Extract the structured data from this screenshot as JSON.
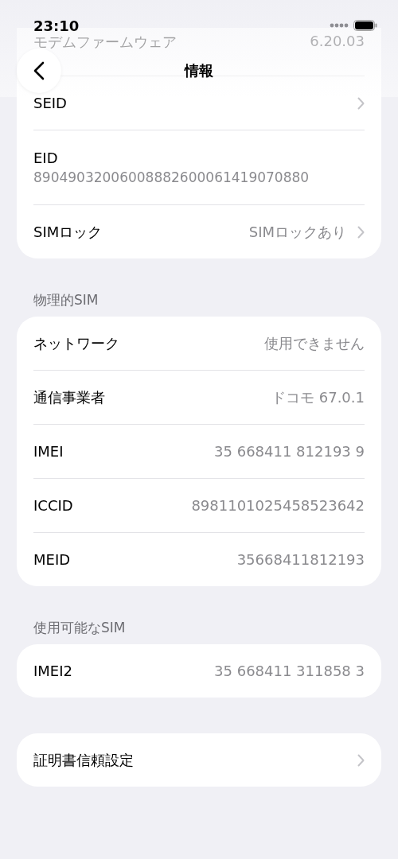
{
  "status_bar": {
    "time": "23:10"
  },
  "nav": {
    "title": "情報"
  },
  "sections": [
    {
      "rows": [
        {
          "kind": "obscured",
          "label": "モデムファームウェア",
          "value": "6.20.03",
          "chevron": false
        },
        {
          "kind": "inline",
          "label": "SEID",
          "chevron": true
        },
        {
          "kind": "stacked",
          "label": "EID",
          "value": "89049032006008882600061419070880",
          "chevron": false
        },
        {
          "kind": "inline",
          "label": "SIMロック",
          "value": "SIMロックあり",
          "chevron": true
        }
      ]
    },
    {
      "header": "物理的SIM",
      "rows": [
        {
          "kind": "inline",
          "label": "ネットワーク",
          "value": "使用できません",
          "chevron": false
        },
        {
          "kind": "inline",
          "label": "通信事業者",
          "value": "ドコモ 67.0.1",
          "chevron": false
        },
        {
          "kind": "inline",
          "label": "IMEI",
          "value": "35 668411 812193 9",
          "chevron": false
        },
        {
          "kind": "inline",
          "label": "ICCID",
          "value": "8981101025458523642",
          "chevron": false
        },
        {
          "kind": "inline",
          "label": "MEID",
          "value": "35668411812193",
          "chevron": false
        }
      ]
    },
    {
      "header": "使用可能なSIM",
      "rows": [
        {
          "kind": "inline",
          "label": "IMEI2",
          "value": "35 668411 311858 3",
          "chevron": false
        }
      ]
    },
    {
      "rows": [
        {
          "kind": "inline",
          "label": "証明書信頼設定",
          "chevron": true
        }
      ]
    }
  ]
}
